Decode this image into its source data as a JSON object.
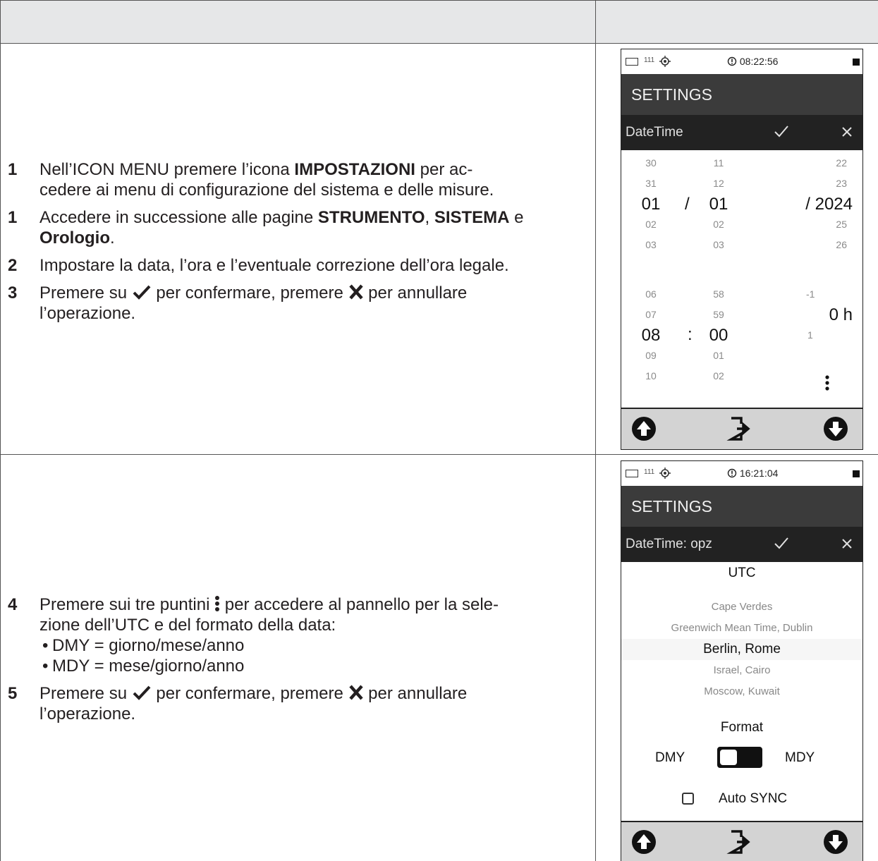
{
  "section1": {
    "steps": [
      {
        "num": "1",
        "parts": [
          "Nell’ICON MENU premere l’icona ",
          "IMPOSTAZIONI",
          " per ac-",
          "cedere ai menu di configurazione del sistema e delle misure."
        ]
      },
      {
        "num": "1",
        "parts": [
          "Accedere in successione alle pagine ",
          "STRUMENTO",
          ", ",
          "SISTEMA",
          " e",
          "Orologio",
          "."
        ]
      },
      {
        "num": "2",
        "text": "Impostare la data, l’ora e l’eventuale correzione dell’ora legale."
      },
      {
        "num": "3",
        "parts": [
          "Premere su ",
          " per confermare, premere ",
          " per annullare",
          "l’operazione."
        ]
      }
    ],
    "device": {
      "signal": "111",
      "time": "08:22:56",
      "title": "SETTINGS",
      "subtitle": "DateTime",
      "date_day": [
        "30",
        "31",
        "01",
        "02",
        "03"
      ],
      "date_month": [
        "11",
        "12",
        "01",
        "02",
        "03"
      ],
      "date_year": [
        "22",
        "23",
        "/ 2024",
        "25",
        "26"
      ],
      "date_sep": "/",
      "hour": [
        "06",
        "07",
        "08",
        "09",
        "10"
      ],
      "minute": [
        "58",
        "59",
        "00",
        "01",
        "02"
      ],
      "time_sep": ":",
      "dst": [
        "-1",
        "0 h",
        "1"
      ]
    }
  },
  "section2": {
    "steps": [
      {
        "num": "4",
        "parts": [
          "Premere sui tre puntini ",
          " per accedere al pannello per la sele-",
          "zione dell’UTC e del formato della data:"
        ],
        "bullets": [
          "DMY = giorno/mese/anno",
          "MDY = mese/giorno/anno"
        ]
      },
      {
        "num": "5",
        "parts": [
          "Premere su ",
          "  per confermare, premere ",
          " per annullare",
          "l’operazione."
        ]
      }
    ],
    "device": {
      "signal": "111",
      "time": "16:21:04",
      "title": "SETTINGS",
      "subtitle": "DateTime: opz",
      "utc_label": "UTC",
      "zones": [
        "Cape Verdes",
        "Greenwich Mean Time, Dublin",
        "Berlin, Rome",
        "Israel, Cairo",
        "Moscow, Kuwait"
      ],
      "format_label": "Format",
      "format_left": "DMY",
      "format_right": "MDY",
      "auto_sync": "Auto SYNC",
      "auto_sync_checked": false
    }
  }
}
